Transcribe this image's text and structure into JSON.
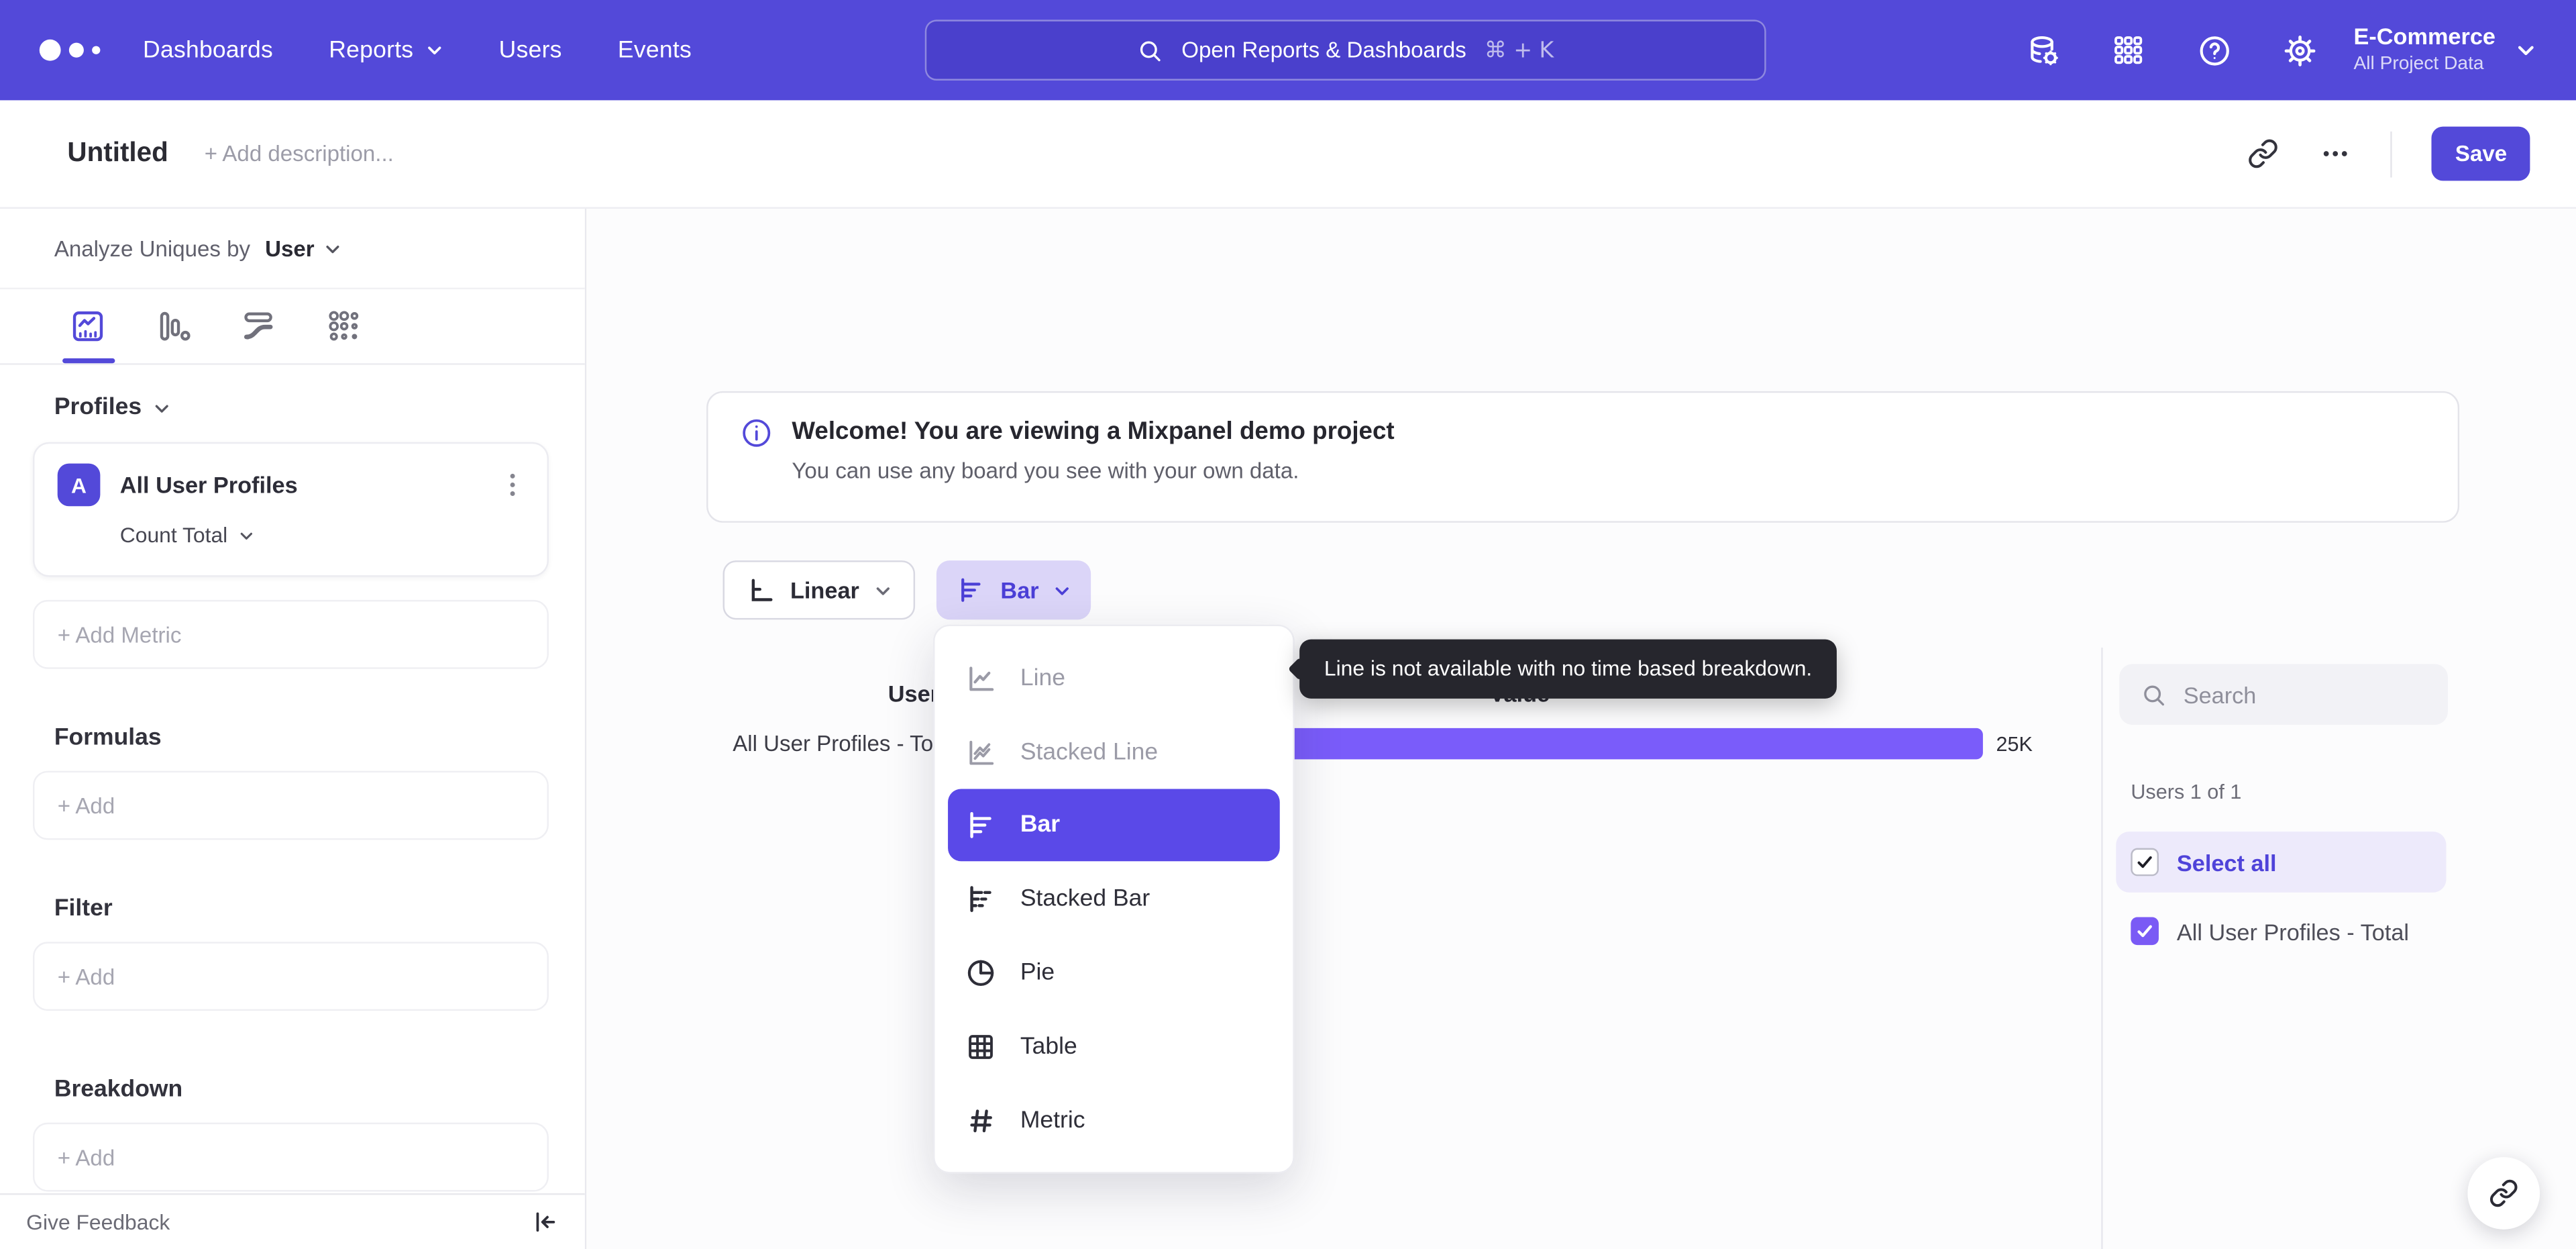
{
  "nav": {
    "items": [
      {
        "label": "Dashboards"
      },
      {
        "label": "Reports"
      },
      {
        "label": "Users"
      },
      {
        "label": "Events"
      }
    ],
    "search": {
      "placeholder": "Open Reports & Dashboards",
      "shortcut": "⌘ + K"
    },
    "project": {
      "name": "E-Commerce",
      "scope": "All Project Data"
    }
  },
  "titlebar": {
    "title": "Untitled",
    "description_placeholder": "+ Add description...",
    "save_label": "Save"
  },
  "sidebar": {
    "analyze_label": "Analyze Uniques by",
    "analyze_value": "User",
    "tabs": [
      {
        "name": "insights",
        "active": true
      },
      {
        "name": "funnels",
        "active": false
      },
      {
        "name": "flows",
        "active": false
      },
      {
        "name": "retention",
        "active": false
      }
    ],
    "profiles_heading": "Profiles",
    "metric": {
      "badge": "A",
      "name": "All User Profiles",
      "aggregation": "Count Total"
    },
    "add_metric_label": "+  Add Metric",
    "sections": [
      {
        "title": "Formulas",
        "add_label": "+  Add"
      },
      {
        "title": "Filter",
        "add_label": "+  Add"
      },
      {
        "title": "Breakdown",
        "add_label": "+  Add"
      }
    ],
    "feedback_label": "Give Feedback"
  },
  "banner": {
    "title": "Welcome! You are viewing a Mixpanel demo project",
    "subtitle": "You can use any board you see with your own data."
  },
  "controls": {
    "scale_label": "Linear",
    "chart_type_label": "Bar"
  },
  "chart_type_menu": {
    "items": [
      {
        "label": "Line",
        "state": "disabled"
      },
      {
        "label": "Stacked Line",
        "state": "disabled"
      },
      {
        "label": "Bar",
        "state": "selected"
      },
      {
        "label": "Stacked Bar",
        "state": "normal"
      },
      {
        "label": "Pie",
        "state": "normal"
      },
      {
        "label": "Table",
        "state": "normal"
      },
      {
        "label": "Metric",
        "state": "normal"
      }
    ]
  },
  "tooltip": {
    "text": "Line is not available with no time based breakdown."
  },
  "chart": {
    "type": "bar",
    "columns": {
      "users": "Users",
      "value": "Value"
    },
    "rows": [
      {
        "label": "All User Profiles - Total",
        "value_label": "25K",
        "value": 25000
      }
    ]
  },
  "legend": {
    "search_placeholder": "Search",
    "count_label": "Users 1 of 1",
    "select_all_label": "Select all",
    "items": [
      {
        "label": "All User Profiles - Total",
        "checked": true
      }
    ]
  },
  "colors": {
    "nav_background": "#5349D9",
    "accent": "#5349D9",
    "bar_fill": "#7A5CFA",
    "selected_menu_item": "#5A49E8",
    "checkbox_checked": "#7A5AF5",
    "tooltip_background": "#26262D"
  }
}
